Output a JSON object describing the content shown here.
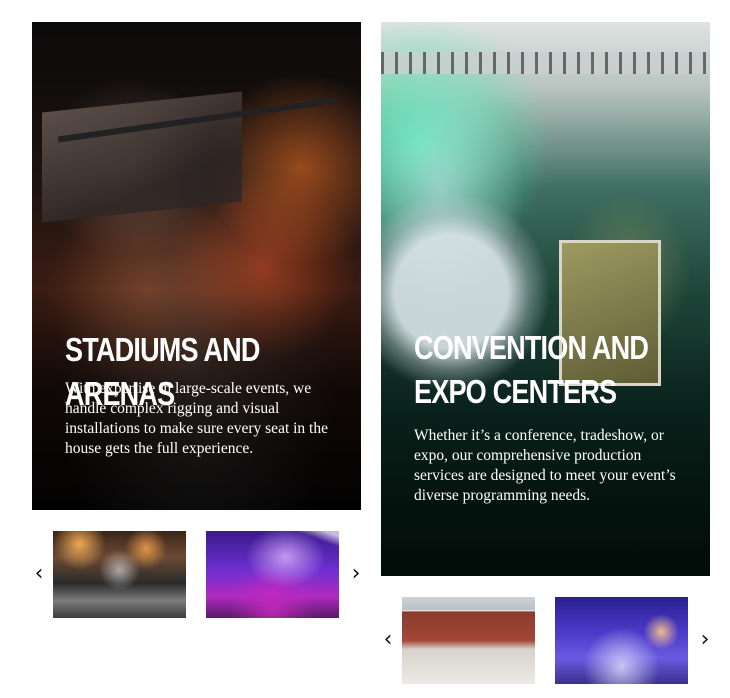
{
  "cards": [
    {
      "title": "Stadiums and Arenas",
      "description": "With expertise in large-scale events, we handle complex rigging and visual installations to make sure every seat in the house gets the full experience."
    },
    {
      "title": "Convention and Expo Centers",
      "description": "Whether it’s a conference, tradeshow, or expo, our comprehensive production services are designed to meet your event’s diverse programming needs."
    }
  ],
  "carousels": [
    {
      "prev_icon": "‹",
      "next_icon": "›"
    },
    {
      "prev_icon": "‹",
      "next_icon": "›"
    }
  ]
}
